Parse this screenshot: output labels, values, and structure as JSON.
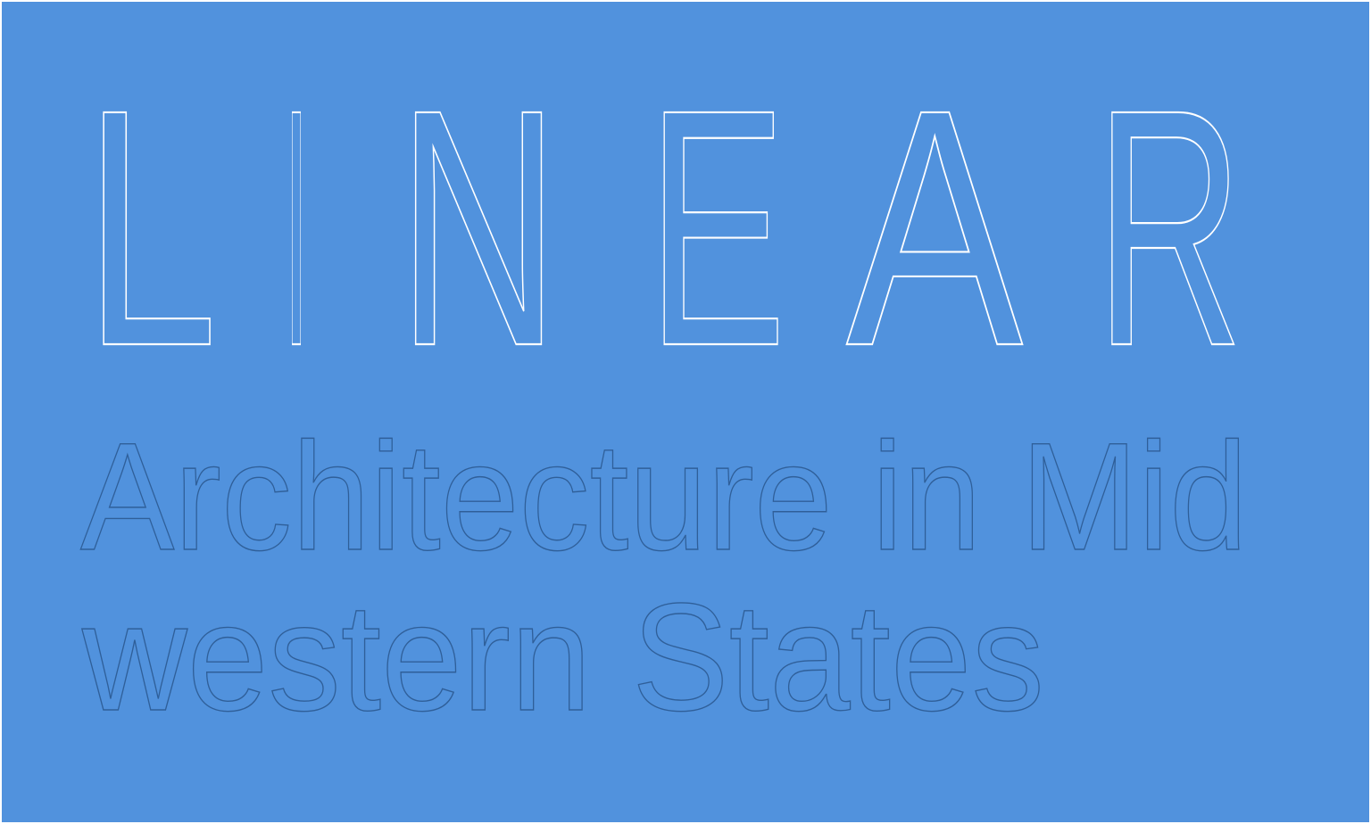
{
  "background_color": "#5192dd",
  "title": {
    "letters": [
      "L",
      "I",
      "N",
      "E",
      "A",
      "R"
    ],
    "stroke_color": "#ffffff"
  },
  "subtitle": {
    "line1": "Architecture in Mid",
    "line2": "western States",
    "stroke_color": "#2f5f99"
  }
}
